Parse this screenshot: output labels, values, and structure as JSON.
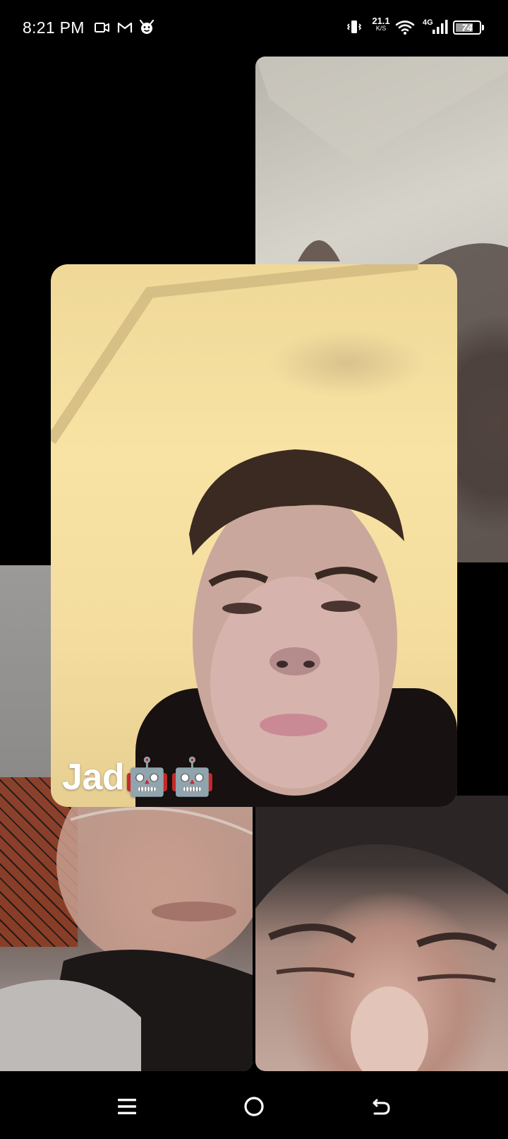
{
  "status_bar": {
    "time": "8:21 PM",
    "net_speed_value": "21.1",
    "net_speed_unit": "K/S",
    "network_type": "4G",
    "battery_level": "74",
    "battery_fraction": 0.74,
    "notification_icons": [
      "video-camera-icon",
      "gmail-icon",
      "devil-icon"
    ],
    "system_icons": [
      "vibrate-icon",
      "wifi-icon",
      "signal-icon",
      "battery-icon"
    ]
  },
  "call": {
    "main_participant": {
      "name": "Jad🤖🤖"
    },
    "participant_tiles": [
      "top-right",
      "bottom-left",
      "bottom-right"
    ]
  },
  "nav_bar": {
    "buttons": [
      "menu-icon",
      "home-icon",
      "back-icon"
    ]
  }
}
